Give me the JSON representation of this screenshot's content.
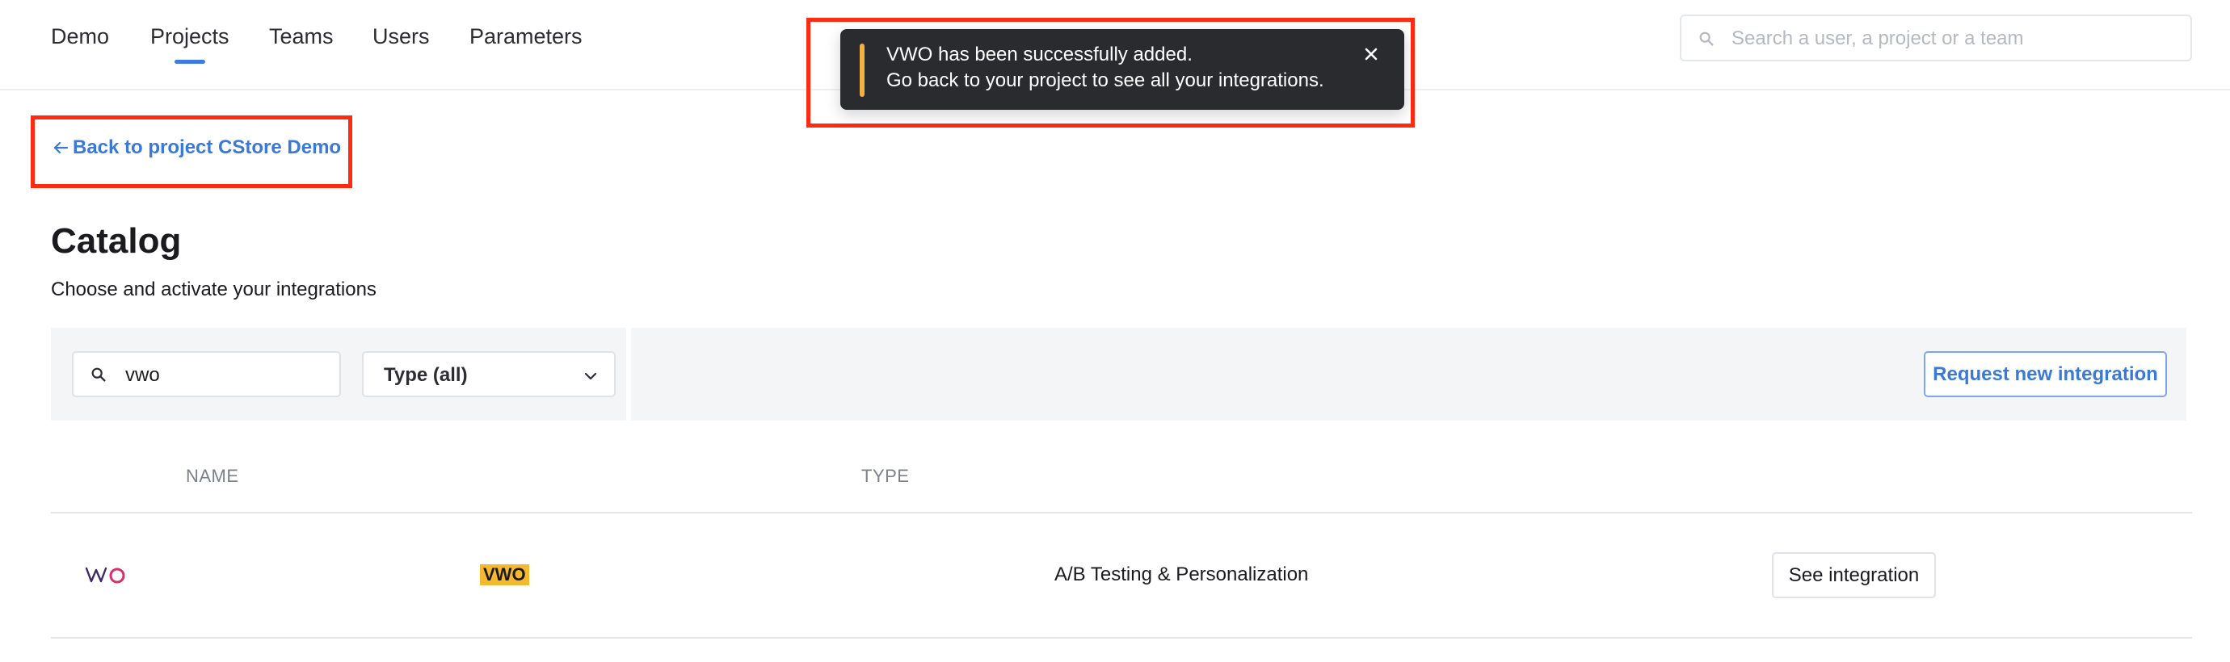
{
  "nav": {
    "items": [
      {
        "label": "Demo",
        "active": false
      },
      {
        "label": "Projects",
        "active": true
      },
      {
        "label": "Teams",
        "active": false
      },
      {
        "label": "Users",
        "active": false
      },
      {
        "label": "Parameters",
        "active": false
      }
    ],
    "search_placeholder": "Search a user, a project or a team"
  },
  "toast": {
    "line1": "VWO has been successfully added.",
    "line2": "Go back to your project to see all your integrations.",
    "accent_color": "#f1b245",
    "close_icon": "close-icon"
  },
  "back_link": "Back to project CStore Demo",
  "catalog": {
    "title": "Catalog",
    "subtitle": "Choose and activate your integrations"
  },
  "filters": {
    "search_value": "vwo",
    "type_value": "Type (all)",
    "request_button": "Request new integration"
  },
  "table": {
    "headers": {
      "name": "NAME",
      "type": "TYPE"
    },
    "rows": [
      {
        "logo_icon": "vwo-logo-icon",
        "name": "VWO",
        "type": "A/B Testing & Personalization",
        "action": "See integration"
      }
    ]
  },
  "colors": {
    "accent_blue": "#3b79d6",
    "highlight_red": "#ff2a12",
    "name_badge": "#f5b82e"
  }
}
